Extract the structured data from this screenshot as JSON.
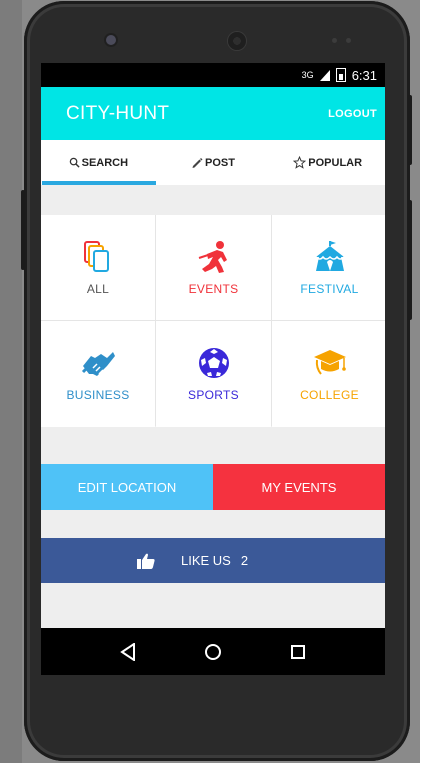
{
  "status_bar": {
    "signal": "3G",
    "time": "6:31"
  },
  "app_bar": {
    "title": "CITY-HUNT",
    "logout_label": "LOGOUT"
  },
  "tabs": [
    {
      "label": "SEARCH",
      "icon": "search-icon",
      "selected": true
    },
    {
      "label": "POST",
      "icon": "pencil-icon",
      "selected": false
    },
    {
      "label": "POPULAR",
      "icon": "star-icon",
      "selected": false
    }
  ],
  "categories": [
    {
      "label": "ALL",
      "icon": "cards-icon",
      "color": "#555555"
    },
    {
      "label": "EVENTS",
      "icon": "event-person-icon",
      "color": "#f0323a"
    },
    {
      "label": "FESTIVAL",
      "icon": "tent-icon",
      "color": "#21a9e1"
    },
    {
      "label": "BUSINESS",
      "icon": "handshake-icon",
      "color": "#2f8fc9"
    },
    {
      "label": "SPORTS",
      "icon": "soccer-ball-icon",
      "color": "#3a28d9"
    },
    {
      "label": "COLLEGE",
      "icon": "graduation-cap-icon",
      "color": "#f6a300"
    }
  ],
  "actions": {
    "edit_location_label": "EDIT LOCATION",
    "my_events_label": "MY EVENTS"
  },
  "like_bar": {
    "label": "LIKE US",
    "count": "2",
    "icon": "thumbs-up-icon",
    "color": "#3b5998"
  },
  "colors": {
    "app_bar": "#00e5e5",
    "tab_indicator": "#2aa8e0",
    "edit_location": "#4fc2f7",
    "my_events": "#f5323f"
  }
}
